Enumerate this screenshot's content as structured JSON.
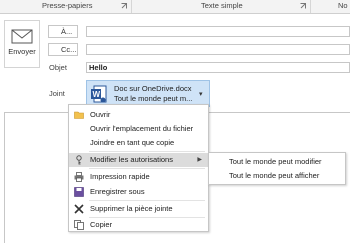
{
  "ribbon": {
    "groups": [
      "Presse-papiers",
      "Texte simple",
      "No"
    ]
  },
  "compose": {
    "send_label": "Envoyer",
    "to_label": "À...",
    "cc_label": "Cc...",
    "subject_label": "Objet",
    "subject_value": "Hello",
    "attach_label": "Joint"
  },
  "attachment": {
    "name": "Doc sur OneDrive.docx",
    "subtitle": "Tout le monde peut m..."
  },
  "context_menu": {
    "items": [
      {
        "label": "Ouvrir",
        "icon": "folder-open-icon"
      },
      {
        "label": "Ouvrir l'emplacement du fichier",
        "icon": ""
      },
      {
        "label": "Joindre en tant que copie",
        "icon": ""
      },
      {
        "label": "Modifier les autorisations",
        "icon": "key-icon"
      },
      {
        "label": "Impression rapide",
        "icon": "printer-icon"
      },
      {
        "label": "Enregistrer sous",
        "icon": "save-icon"
      },
      {
        "label": "Supprimer la pièce jointe",
        "icon": "delete-x-icon"
      },
      {
        "label": "Copier",
        "icon": "copy-icon"
      }
    ],
    "highlighted_index": 3
  },
  "submenu": {
    "items": [
      {
        "label": "Tout le monde peut modifier"
      },
      {
        "label": "Tout le monde peut afficher"
      }
    ]
  }
}
